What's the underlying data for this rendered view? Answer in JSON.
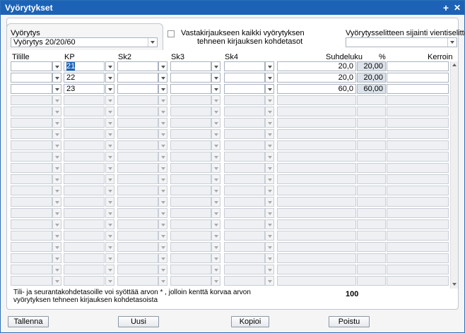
{
  "window": {
    "title": "Vyörytykset",
    "add_icon": "+",
    "close_icon": "✕"
  },
  "vyorytys": {
    "label": "Vyörytys",
    "value": "Vyörytys 20/20/60"
  },
  "vastakirjaus": {
    "line1": "Vastakirjaukseen kaikki vyörytyksen",
    "line2": "tehneen kirjauksen kohdetasot",
    "checked": false
  },
  "selite": {
    "label": "Vyörytysselitteen sijainti vientiselitteessä",
    "value": ""
  },
  "columns": {
    "tilille": "Tilille",
    "kp": "KP",
    "sk2": "Sk2",
    "sk3": "Sk3",
    "sk4": "Sk4",
    "suhdeluku": "Suhdeluku",
    "pct": "%",
    "kerroin": "Kerroin"
  },
  "rows": [
    {
      "tilille": "",
      "kp": "21",
      "sk2": "",
      "sk3": "",
      "sk4": "",
      "suhdeluku": "20,0",
      "pct": "20,00",
      "kerroin": ""
    },
    {
      "tilille": "",
      "kp": "22",
      "sk2": "",
      "sk3": "",
      "sk4": "",
      "suhdeluku": "20,0",
      "pct": "20,00",
      "kerroin": ""
    },
    {
      "tilille": "",
      "kp": "23",
      "sk2": "",
      "sk3": "",
      "sk4": "",
      "suhdeluku": "60,0",
      "pct": "60,00",
      "kerroin": ""
    }
  ],
  "empty_row_count": 17,
  "note": {
    "line1": "Tili- ja seurantakohdetasoille voi syöttää arvon * , jolloin kenttä korvaa arvon",
    "line2": "vyörytyksen tehneen kirjauksen kohdetasoista"
  },
  "total": "100",
  "buttons": {
    "save": "Tallenna",
    "new": "Uusi",
    "copy": "Kopioi",
    "delete": "Poistu"
  }
}
